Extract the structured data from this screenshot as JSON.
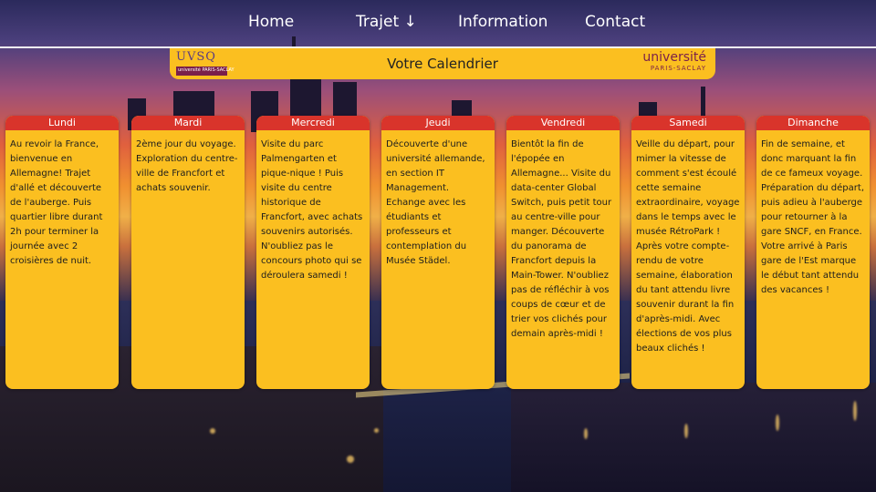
{
  "nav": {
    "items": [
      {
        "label": "Home"
      },
      {
        "label": "Trajet ↓"
      },
      {
        "label": "Information"
      },
      {
        "label": "Contact"
      }
    ]
  },
  "banner": {
    "title": "Votre Calendrier",
    "logo_left": {
      "text": "UVSQ",
      "subtext": "université PARIS-SACLAY"
    },
    "logo_right": {
      "text": "université",
      "subtext": "PARIS-SACLAY"
    }
  },
  "days": [
    {
      "name": "Lundi",
      "text": "Au revoir la France, bienvenue en Allemagne! Trajet d'allé et découverte de l'auberge. Puis quartier libre durant 2h pour terminer la journée avec 2 croisières de nuit."
    },
    {
      "name": "Mardi",
      "text": "2ème jour du voyage. Exploration du centre-ville de Francfort et achats souvenir."
    },
    {
      "name": "Mercredi",
      "text": "Visite du parc Palmengarten et pique-nique ! Puis visite du centre historique de Francfort, avec achats souvenirs autorisés. N'oubliez pas le concours photo qui se déroulera samedi !"
    },
    {
      "name": "Jeudi",
      "text": "Découverte d'une université allemande, en section IT Management. Echange avec les étudiants et professeurs et contemplation du Musée Städel."
    },
    {
      "name": "Vendredi",
      "text": "Bientôt la fin de l'épopée en Allemagne... Visite du data-center Global Switch, puis petit tour au centre-ville pour manger. Découverte du panorama de Francfort depuis la Main-Tower. N'oubliez pas de réfléchir à vos coups de cœur et de trier vos clichés pour demain après-midi !"
    },
    {
      "name": "Samedi",
      "text": "Veille du départ, pour mimer la vitesse de comment s'est écoulé cette semaine extraordinaire, voyage dans le temps avec le musée RétroPark ! Après votre compte-rendu de votre semaine, élaboration du tant attendu livre souvenir durant la fin d'après-midi. Avec élections de vos plus beaux clichés !"
    },
    {
      "name": "Dimanche",
      "text": "Fin de semaine, et donc marquant la fin de ce fameux voyage. Préparation du départ, puis adieu à l'auberge pour retourner à la gare SNCF, en France. Votre arrivé à Paris gare de l'Est marque le début tant attendu des vacances !"
    }
  ],
  "colors": {
    "card_bg": "#fbbf20",
    "card_header": "#d9342b",
    "banner_bg": "#fbbf20",
    "nav_text": "#ffffff"
  }
}
